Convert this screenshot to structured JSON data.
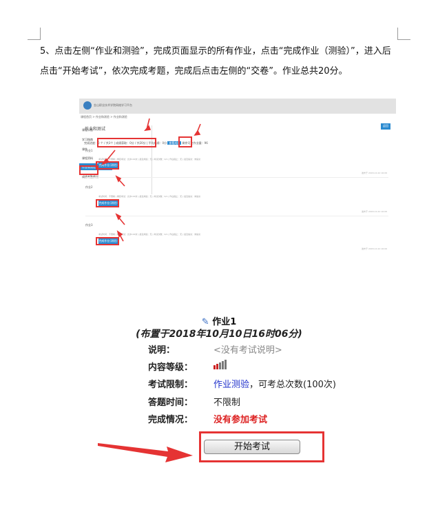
{
  "paragraph": {
    "text": "5、点击左侧“作业和测验”，完成页面显示的所有作业，点击“完成作业（测验）”，进入后点击“开始考试”，依次完成考题，完成后点击左侧的“交卷”。作业总共20分。"
  },
  "screenshot1": {
    "logo_text": "金山职业技术学院网络学习平台",
    "breadcrumb": "课程首页 > 作业和测验 > 作业和测验",
    "sidebar": [
      "课程公告",
      "学习指南",
      "课件",
      "课程资料",
      "作业和测验",
      "成绩考勤情况"
    ],
    "section_title": "作业和测试",
    "top_button": "返回",
    "stats": "完成进度：0 个 / 共3个 | 成绩获取：0分 / 共20分 | 平均成绩：0分",
    "stats_btn": "查看成绩",
    "stats_tail": "剩余可交作业量：96",
    "homeworks": [
      {
        "name": "作业1",
        "meta": "考试时间：不限制 | 重复考试：允许100次 | 最近成绩：无 | 考试次数：0/1 | 作业截止：无 | 最近提交：未提交",
        "btn": "完成作业(测验)",
        "date": "发布于 2018-10-10 16:06"
      },
      {
        "name": "作业2",
        "meta": "考试时间：不限制 | 重复考试：允许100次 | 最近成绩：无 | 考试次数：0/1 | 作业截止：无 | 最近提交：未提交",
        "btn": "完成作业(测验)",
        "date": "发布于 2018-10-10 16:06"
      },
      {
        "name": "作业3",
        "meta": "考试时间：不限制 | 重复考试：允许100次 | 最近成绩：无 | 考试次数：0/1 | 作业截止：无 | 最近提交：未提交",
        "btn": "完成作业(测验)",
        "date": "发布于 2018-10-10 16:06"
      }
    ]
  },
  "exam": {
    "title": "作业1",
    "subtitle": "(布置于2018年10月10日16时06分)",
    "rows": [
      {
        "label": "说明：",
        "value": "<没有考试说明>"
      },
      {
        "label": "内容等级：",
        "value": ""
      },
      {
        "label": "考试限制：",
        "value_link": "作业测验",
        "value": "，可考总次数(100次)"
      },
      {
        "label": "答题时间：",
        "value": "不限制"
      },
      {
        "label": "完成情况：",
        "value": "没有参加考试"
      }
    ],
    "start_button": "开始考试"
  },
  "colors": {
    "accent_blue": "#2a8ad0",
    "highlight_red": "#e53333",
    "link_blue": "#2233cc"
  }
}
